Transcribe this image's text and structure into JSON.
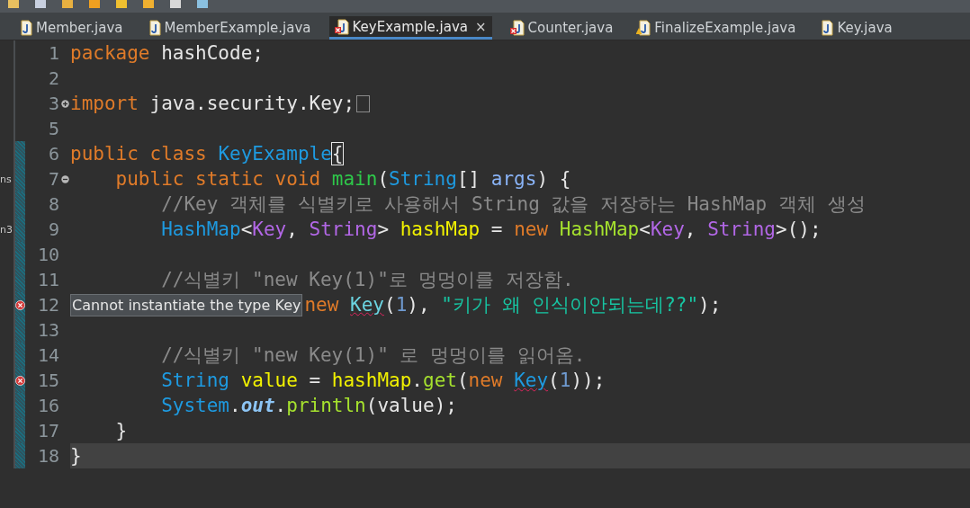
{
  "tabs": [
    {
      "label": "Member.java",
      "kind": "java",
      "selected": false
    },
    {
      "label": "MemberExample.java",
      "kind": "java",
      "selected": false
    },
    {
      "label": "KeyExample.java",
      "kind": "error",
      "selected": true,
      "close": "×"
    },
    {
      "label": "Counter.java",
      "kind": "error",
      "selected": false
    },
    {
      "label": "FinalizeExample.java",
      "kind": "warning",
      "selected": false
    },
    {
      "label": "Key.java",
      "kind": "java",
      "selected": false
    }
  ],
  "editor": {
    "lines": [
      {
        "number": "1",
        "error": false,
        "folded": false,
        "fold_open": false,
        "changed": false,
        "current": false,
        "tokens": [
          {
            "kind": "keyword",
            "t": "package "
          },
          {
            "kind": "plain",
            "t": "hashCode;"
          }
        ]
      },
      {
        "number": "2",
        "error": false,
        "folded": false,
        "fold_open": false,
        "changed": false,
        "current": false
      },
      {
        "number": "3",
        "error": false,
        "folded": true,
        "fold_open": false,
        "changed": false,
        "current": false,
        "tokens": [
          {
            "kind": "keyword",
            "t": "import "
          },
          {
            "kind": "plain",
            "t": "java.security.Key;"
          }
        ]
      },
      {
        "number": "5",
        "error": false,
        "folded": false,
        "fold_open": false,
        "changed": false,
        "current": false
      },
      {
        "number": "6",
        "error": false,
        "folded": false,
        "fold_open": false,
        "changed": true,
        "current": false,
        "tokens": [
          {
            "kind": "keyword",
            "t": "public class "
          },
          {
            "kind": "type",
            "t": "KeyExample"
          },
          {
            "kind": "bracket",
            "t": "{"
          }
        ]
      },
      {
        "number": "7",
        "error": false,
        "folded": false,
        "fold_open": true,
        "changed": true,
        "current": false,
        "panel_text": "ns",
        "tokens": [
          {
            "kind": "keyword",
            "t": "    public static void "
          },
          {
            "kind": "decl",
            "t": "main"
          },
          {
            "kind": "plain",
            "t": "("
          },
          {
            "kind": "type",
            "t": "String"
          },
          {
            "kind": "plain",
            "t": "[] "
          },
          {
            "kind": "param",
            "t": "args"
          },
          {
            "kind": "plain",
            "t": ") {"
          }
        ]
      },
      {
        "number": "8",
        "error": false,
        "folded": false,
        "fold_open": false,
        "changed": true,
        "current": false,
        "tokens": [
          {
            "kind": "comment",
            "t": "        //Key 객체를 식별키로 사용해서 String 값을 저장하는 HashMap 객체 생성"
          }
        ]
      },
      {
        "number": "9",
        "error": false,
        "folded": false,
        "fold_open": false,
        "changed": true,
        "current": false,
        "panel_text": "n3",
        "tokens": [
          {
            "kind": "type",
            "t": "        HashMap"
          },
          {
            "kind": "plain",
            "t": "<"
          },
          {
            "kind": "generic",
            "t": "Key"
          },
          {
            "kind": "plain",
            "t": ", "
          },
          {
            "kind": "generic",
            "t": "String"
          },
          {
            "kind": "plain",
            "t": "> "
          },
          {
            "kind": "variable",
            "t": "hashMap"
          },
          {
            "kind": "plain",
            "t": " = "
          },
          {
            "kind": "keyword",
            "t": "new "
          },
          {
            "kind": "method",
            "t": "HashMap"
          },
          {
            "kind": "plain",
            "t": "<"
          },
          {
            "kind": "generic",
            "t": "Key"
          },
          {
            "kind": "plain",
            "t": ", "
          },
          {
            "kind": "generic",
            "t": "String"
          },
          {
            "kind": "plain",
            "t": ">();"
          }
        ]
      },
      {
        "number": "10",
        "error": false,
        "folded": false,
        "fold_open": false,
        "changed": true,
        "current": false
      },
      {
        "number": "11",
        "error": false,
        "folded": false,
        "fold_open": false,
        "changed": true,
        "current": false,
        "tokens": [
          {
            "kind": "comment",
            "t": "        //식별키 \"new Key(1)\"로 멍멍이를 저장함."
          }
        ]
      },
      {
        "number": "12",
        "error": true,
        "folded": false,
        "fold_open": false,
        "changed": true,
        "current": false,
        "tooltip": "Cannot instantiate the type Key",
        "tokens": [
          {
            "kind": "keyword",
            "t": "new "
          },
          {
            "kind": "error",
            "t": "Key"
          },
          {
            "kind": "plain",
            "t": "("
          },
          {
            "kind": "number",
            "t": "1"
          },
          {
            "kind": "plain",
            "t": "), "
          },
          {
            "kind": "string",
            "t": "\"키가 왜 인식이안되는데??\""
          },
          {
            "kind": "plain",
            "t": ");"
          }
        ]
      },
      {
        "number": "13",
        "error": false,
        "folded": false,
        "fold_open": false,
        "changed": true,
        "current": false
      },
      {
        "number": "14",
        "error": false,
        "folded": false,
        "fold_open": false,
        "changed": true,
        "current": false,
        "tokens": [
          {
            "kind": "comment",
            "t": "        //식별키 \"new Key(1)\" 로 멍멍이를 읽어옴."
          }
        ]
      },
      {
        "number": "15",
        "error": true,
        "folded": false,
        "fold_open": false,
        "changed": true,
        "current": false,
        "tokens": [
          {
            "kind": "type",
            "t": "        String "
          },
          {
            "kind": "variable",
            "t": "value"
          },
          {
            "kind": "plain",
            "t": " = "
          },
          {
            "kind": "variable",
            "t": "hashMap"
          },
          {
            "kind": "plain",
            "t": "."
          },
          {
            "kind": "method",
            "t": "get"
          },
          {
            "kind": "plain",
            "t": "("
          },
          {
            "kind": "keyword",
            "t": "new "
          },
          {
            "kind": "error_type",
            "t": "Key"
          },
          {
            "kind": "plain",
            "t": "("
          },
          {
            "kind": "number",
            "t": "1"
          },
          {
            "kind": "plain",
            "t": "));"
          }
        ]
      },
      {
        "number": "16",
        "error": false,
        "folded": false,
        "fold_open": false,
        "changed": true,
        "current": false,
        "tokens": [
          {
            "kind": "type",
            "t": "        System"
          },
          {
            "kind": "plain",
            "t": "."
          },
          {
            "kind": "static",
            "t": "out"
          },
          {
            "kind": "plain",
            "t": "."
          },
          {
            "kind": "method",
            "t": "println"
          },
          {
            "kind": "plain",
            "t": "(value);"
          }
        ]
      },
      {
        "number": "17",
        "error": false,
        "folded": false,
        "fold_open": false,
        "changed": true,
        "current": false,
        "tokens": [
          {
            "kind": "plain",
            "t": "    }"
          }
        ]
      },
      {
        "number": "18",
        "error": false,
        "folded": false,
        "fold_open": false,
        "changed": true,
        "current": true,
        "tokens": [
          {
            "kind": "plain",
            "t": "}"
          }
        ]
      }
    ]
  }
}
